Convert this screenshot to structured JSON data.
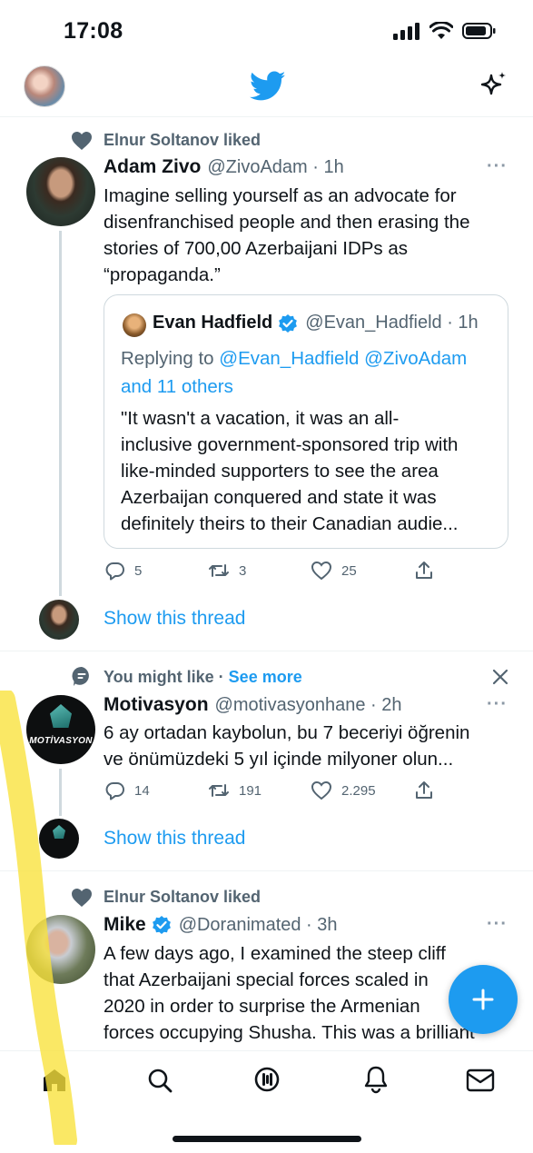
{
  "status_bar": {
    "time": "17:08"
  },
  "tweets": [
    {
      "context": "Elnur Soltanov liked",
      "name": "Adam Zivo",
      "handle": "@ZivoAdam · 1h",
      "text_lines": [
        "Imagine selling yourself as an advocate for",
        "disenfranchised people and then erasing the",
        "stories of 700,00 Azerbaijani IDPs as",
        "“propaganda.”"
      ],
      "quote": {
        "name": "Evan Hadfield",
        "handle": "@Evan_Hadfield · 1h",
        "replying_prefix": "Replying to ",
        "replying_users": "@Evan_Hadfield @ZivoAdam",
        "replying_others": "and 11 others",
        "text_lines": [
          "\"It wasn't a vacation, it was an all-",
          "inclusive government-sponsored trip with",
          "like-minded supporters to see the area",
          "Azerbaijan conquered and state it was",
          "definitely theirs to their Canadian audie..."
        ]
      },
      "replies": "5",
      "retweets": "3",
      "likes": "25",
      "show_thread": "Show this thread"
    },
    {
      "context_prefix": "You might like · ",
      "context_link": "See more",
      "name": "Motivasyon",
      "handle": "@motivasyonhane · 2h",
      "avatar_text": "MOTİVASYON",
      "text_lines": [
        "6 ay ortadan kaybolun, bu 7 beceriyi öğrenin",
        "ve önümüzdeki 5 yıl içinde milyoner olun..."
      ],
      "replies": "14",
      "retweets": "191",
      "likes": "2.295",
      "show_thread": "Show this thread"
    },
    {
      "context": "Elnur Soltanov liked",
      "name": "Mike",
      "handle": "@Doranimated · 3h",
      "text_lines": [
        "A few days ago, I examined the steep cliff",
        "that Azerbaijani special forces scaled in",
        "2020 in order to surprise the Armenian",
        "forces occupying Shusha. This was a brilliant"
      ]
    }
  ],
  "colors": {
    "accent": "#1d9bf0",
    "highlighter": "#f8e23a"
  }
}
